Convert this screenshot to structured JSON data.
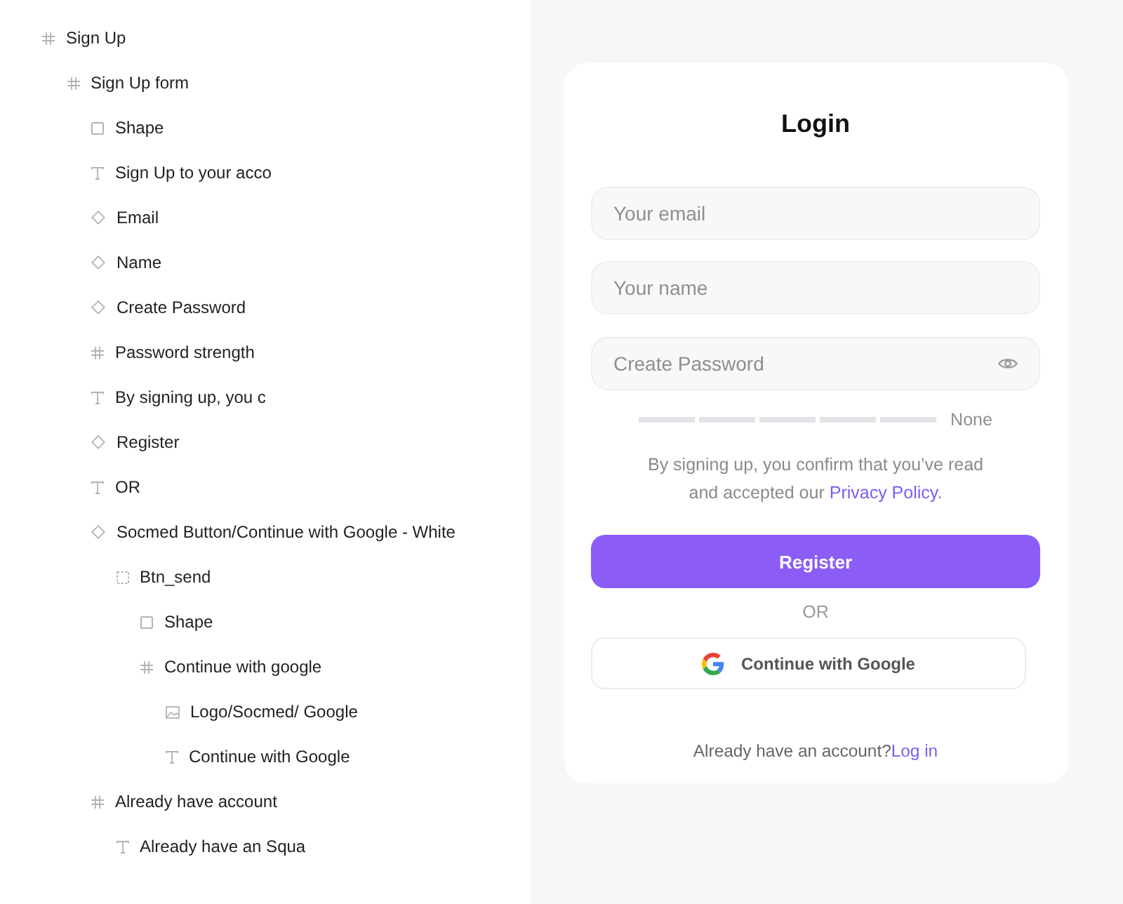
{
  "layers": [
    {
      "name": "Sign Up",
      "kind": "frame",
      "children": [
        {
          "name": "Sign Up form",
          "kind": "frame",
          "children": [
            {
              "name": "Shape",
              "kind": "rectangle"
            },
            {
              "name": "Sign Up to your acco",
              "kind": "text"
            },
            {
              "name": "Email",
              "kind": "component"
            },
            {
              "name": "Name",
              "kind": "component"
            },
            {
              "name": "Create Password",
              "kind": "component"
            },
            {
              "name": "Password strength",
              "kind": "frame"
            },
            {
              "name": "By signing up, you c",
              "kind": "text"
            },
            {
              "name": "Register",
              "kind": "component"
            },
            {
              "name": "OR",
              "kind": "text"
            },
            {
              "name": "Socmed Button/Continue with Google - White",
              "kind": "component",
              "children": [
                {
                  "name": "Btn_send",
                  "kind": "group",
                  "children": [
                    {
                      "name": "Shape",
                      "kind": "rectangle"
                    },
                    {
                      "name": "Continue with google",
                      "kind": "frame",
                      "children": [
                        {
                          "name": "Logo/Socmed/ Google",
                          "kind": "image"
                        },
                        {
                          "name": "Continue with Google",
                          "kind": "text"
                        }
                      ]
                    }
                  ]
                }
              ]
            },
            {
              "name": "Already have account",
              "kind": "frame",
              "children": [
                {
                  "name": "Already have an Squa",
                  "kind": "text"
                }
              ]
            }
          ]
        }
      ]
    }
  ],
  "signup": {
    "title": "Login",
    "fields": [
      {
        "kind": "email",
        "placeholder": "Your email"
      },
      {
        "kind": "name",
        "placeholder": "Your name"
      },
      {
        "kind": "password",
        "placeholder": "Create Password"
      }
    ],
    "password_strength": {
      "level": 0,
      "label": "None"
    },
    "consent": {
      "text": "By signing up, you confirm that you’ve read and accepted our",
      "link": "Privacy Policy",
      "end": "."
    },
    "register_button": "Register",
    "separator": "OR",
    "google_button": "Continue with Google",
    "login_prompt": {
      "text": "Already have an account?",
      "link": "Log in"
    }
  }
}
